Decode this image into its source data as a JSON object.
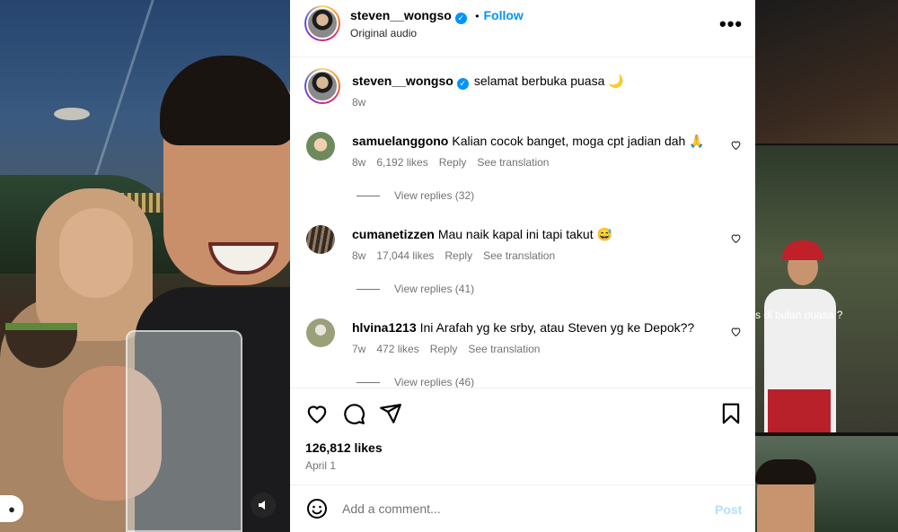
{
  "post": {
    "username": "steven__wongso",
    "verified_icon": "check-icon",
    "follow_label": "Follow",
    "separator": "•",
    "audio": "Original audio",
    "more_label": "•••",
    "caption": "selamat berbuka puasa 🌙",
    "caption_time": "8w"
  },
  "comments": [
    {
      "username": "samuelanggono",
      "text": "Kalian cocok banget, moga cpt jadian dah 🙏",
      "time": "8w",
      "likes": "6,192 likes",
      "reply_label": "Reply",
      "translate_label": "See translation",
      "view_replies": "View replies (32)"
    },
    {
      "username": "cumanetizzen",
      "text": "Mau naik kapal ini tapi takut 😅",
      "time": "8w",
      "likes": "17,044 likes",
      "reply_label": "Reply",
      "translate_label": "See translation",
      "view_replies": "View replies (41)"
    },
    {
      "username": "hlvina1213",
      "text": "Ini Arafah yg ke srby, atau Steven yg ke Depok??",
      "time": "7w",
      "likes": "472 likes",
      "reply_label": "Reply",
      "translate_label": "See translation",
      "view_replies": "View replies (46)"
    }
  ],
  "stats": {
    "likes": "126,812 likes",
    "date": "April 1"
  },
  "composer": {
    "placeholder": "Add a comment...",
    "post_label": "Post"
  },
  "background": {
    "thumb_caption": "s di bulan puasa ?"
  },
  "colors": {
    "accent": "#0095f6",
    "muted": "#737373",
    "post_disabled": "#b2dffc"
  }
}
